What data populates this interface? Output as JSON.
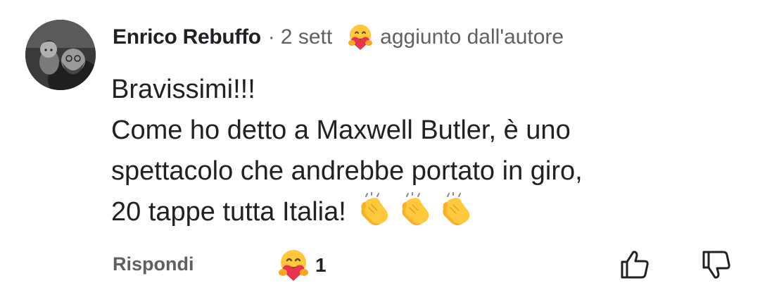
{
  "comment": {
    "author": "Enrico Rebuffo",
    "separator": "·",
    "time": "2 sett",
    "badge_icon": "heart-hug-icon",
    "badge_label": "aggiunto dall'autore",
    "text_lines": [
      "Bravissimi!!!",
      "Come ho detto a Maxwell Butler, è uno",
      "spettacolo che andrebbe portato in giro,",
      "20 tappe tutta Italia!"
    ],
    "emoji_icons": [
      "clapping-hands-icon",
      "clapping-hands-icon",
      "clapping-hands-icon"
    ]
  },
  "actions": {
    "reply_label": "Rispondi",
    "reaction_icon": "heart-hug-icon",
    "reaction_count": "1",
    "like_icon": "thumbs-up-icon",
    "dislike_icon": "thumbs-down-icon"
  },
  "colors": {
    "text_primary": "#202124",
    "text_secondary": "#606060",
    "emoji_yellow": "#FFC83D",
    "heart_red": "#E8344E"
  }
}
